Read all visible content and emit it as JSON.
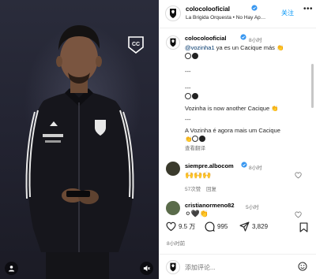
{
  "post": {
    "username": "colocolooficial",
    "audio": "La Brigida Orquesta • No Hay Ap…",
    "follow_label": "关注",
    "more_label": "•••"
  },
  "caption": {
    "username": "colocolooficial",
    "time": "8小时",
    "mention": "@vozinha1",
    "line1_rest": " ya es un Cacique más ",
    "sep": "---",
    "line2": "Vozinha is now another Cacique ",
    "line3": "A Vozinha é agora mais um Cacique",
    "see_translation": "查看翻译"
  },
  "comments": [
    {
      "username": "siempre.albocom",
      "time": "8小时",
      "text": "🙌🙌🙌",
      "likes": "57次赞",
      "reply": "回复"
    },
    {
      "username": "cristianormeno82",
      "time": "5小时",
      "text": "⚪🖤👏"
    }
  ],
  "actions": {
    "likes": "9.5 万",
    "comments": "995",
    "shares": "3,829"
  },
  "date": "8小时前",
  "add_comment": {
    "placeholder": "添加评论..."
  },
  "colors": {
    "accent": "#0095f6",
    "verified": "#3897f0",
    "media_bg": "#232432"
  },
  "icons": [
    "cc-icon",
    "user-icon",
    "mute-icon",
    "more-icon",
    "verified-icon",
    "heart-icon",
    "comment-icon",
    "share-icon",
    "bookmark-icon",
    "emoji-icon"
  ]
}
